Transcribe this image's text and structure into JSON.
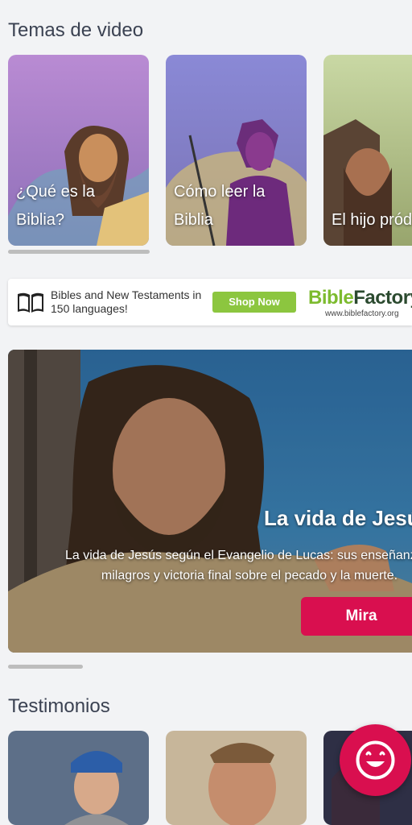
{
  "video_topics": {
    "title": "Temas de video",
    "cards": [
      {
        "label": "¿Qué es la\nBiblia?"
      },
      {
        "label": "Cómo leer la\nBiblia"
      },
      {
        "label": "El hijo pródigo"
      }
    ]
  },
  "ad": {
    "text": "Bibles and New Testaments in 150 languages!",
    "button": "Shop Now",
    "brand_part1": "Bible",
    "brand_part2": "Factory",
    "url": "www.biblefactory.org"
  },
  "hero": {
    "title": "La vida de Jesús",
    "description": "La vida de Jesús según el Evangelio de Lucas: sus enseñanzas,\nmilagros y victoria final sobre el pecado y la muerte.",
    "button": "Mira"
  },
  "testimonials": {
    "title": "Testimonios"
  },
  "colors": {
    "accent": "#d90f4f",
    "ad_green": "#8cc63f"
  }
}
